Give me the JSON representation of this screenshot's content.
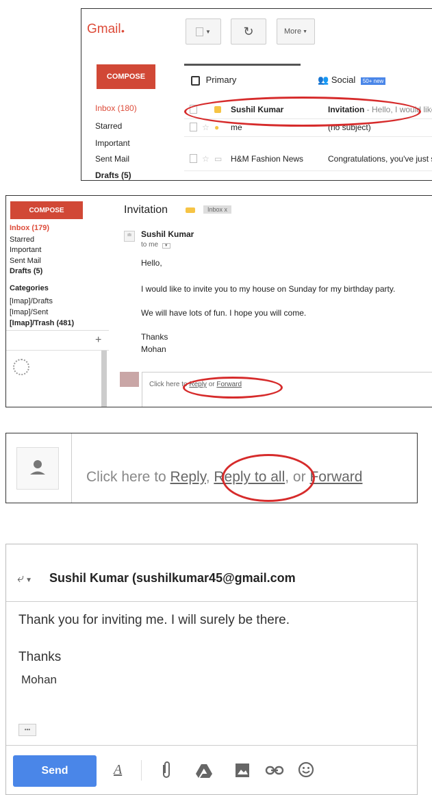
{
  "panel1": {
    "logo": "Gmail",
    "toolbar": {
      "more_label": "More"
    },
    "compose_label": "COMPOSE",
    "nav": [
      "Inbox (180)",
      "Starred",
      "Important",
      "Sent Mail",
      "Drafts (5)"
    ],
    "tabs": [
      {
        "label": "Primary",
        "icon": "inbox-icon"
      },
      {
        "label": "Social",
        "icon": "people-icon",
        "badge": "50+ new"
      }
    ],
    "messages": [
      {
        "sender": "Sushil Kumar",
        "subject": "Invitation",
        "snippet": " - Hello, I would like to"
      },
      {
        "sender": "me",
        "subject": "(no subject)",
        "snippet": ""
      },
      {
        "sender": "H&M Fashion News",
        "subject": "Congratulations, you've just subscr",
        "snippet": ""
      }
    ]
  },
  "panel2": {
    "compose_label": "COMPOSE",
    "nav": [
      "Inbox (179)",
      "Starred",
      "Important",
      "Sent Mail",
      "Drafts (5)"
    ],
    "categories_label": "Categories",
    "folders": [
      "[Imap]/Drafts",
      "[Imap]/Sent",
      "[Imap]/Trash (481)"
    ],
    "subject": "Invitation",
    "inbox_chip": "Inbox x",
    "sender": "Sushil Kumar",
    "to_line": "to me",
    "body": [
      "Hello,",
      "I would like to invite you to my house on Sunday for my birthday party.",
      "We will have lots of fun. I hope you will come.",
      "Thanks",
      "Mohan"
    ],
    "reply_prompt": {
      "prefix": "Click here to ",
      "reply": "Reply",
      "mid": " or ",
      "forward": "Forward"
    }
  },
  "panel3": {
    "prefix": "Click here to ",
    "reply": "Reply",
    "sep": ", ",
    "reply_all": "Reply to all",
    "mid": ", or ",
    "forward": "Forward"
  },
  "panel4": {
    "recipient": "Sushil Kumar (sushilkumar45@gmail.com",
    "body_line": "Thank you for inviting me. I will surely be there.",
    "thanks": "Thanks",
    "signature": "Mohan",
    "ellipsis": "•••",
    "send_label": "Send",
    "format_glyph": "A"
  },
  "colors": {
    "compose_red": "#d14836",
    "highlight_oval": "#d62b2b",
    "send_blue": "#4a86e8"
  }
}
